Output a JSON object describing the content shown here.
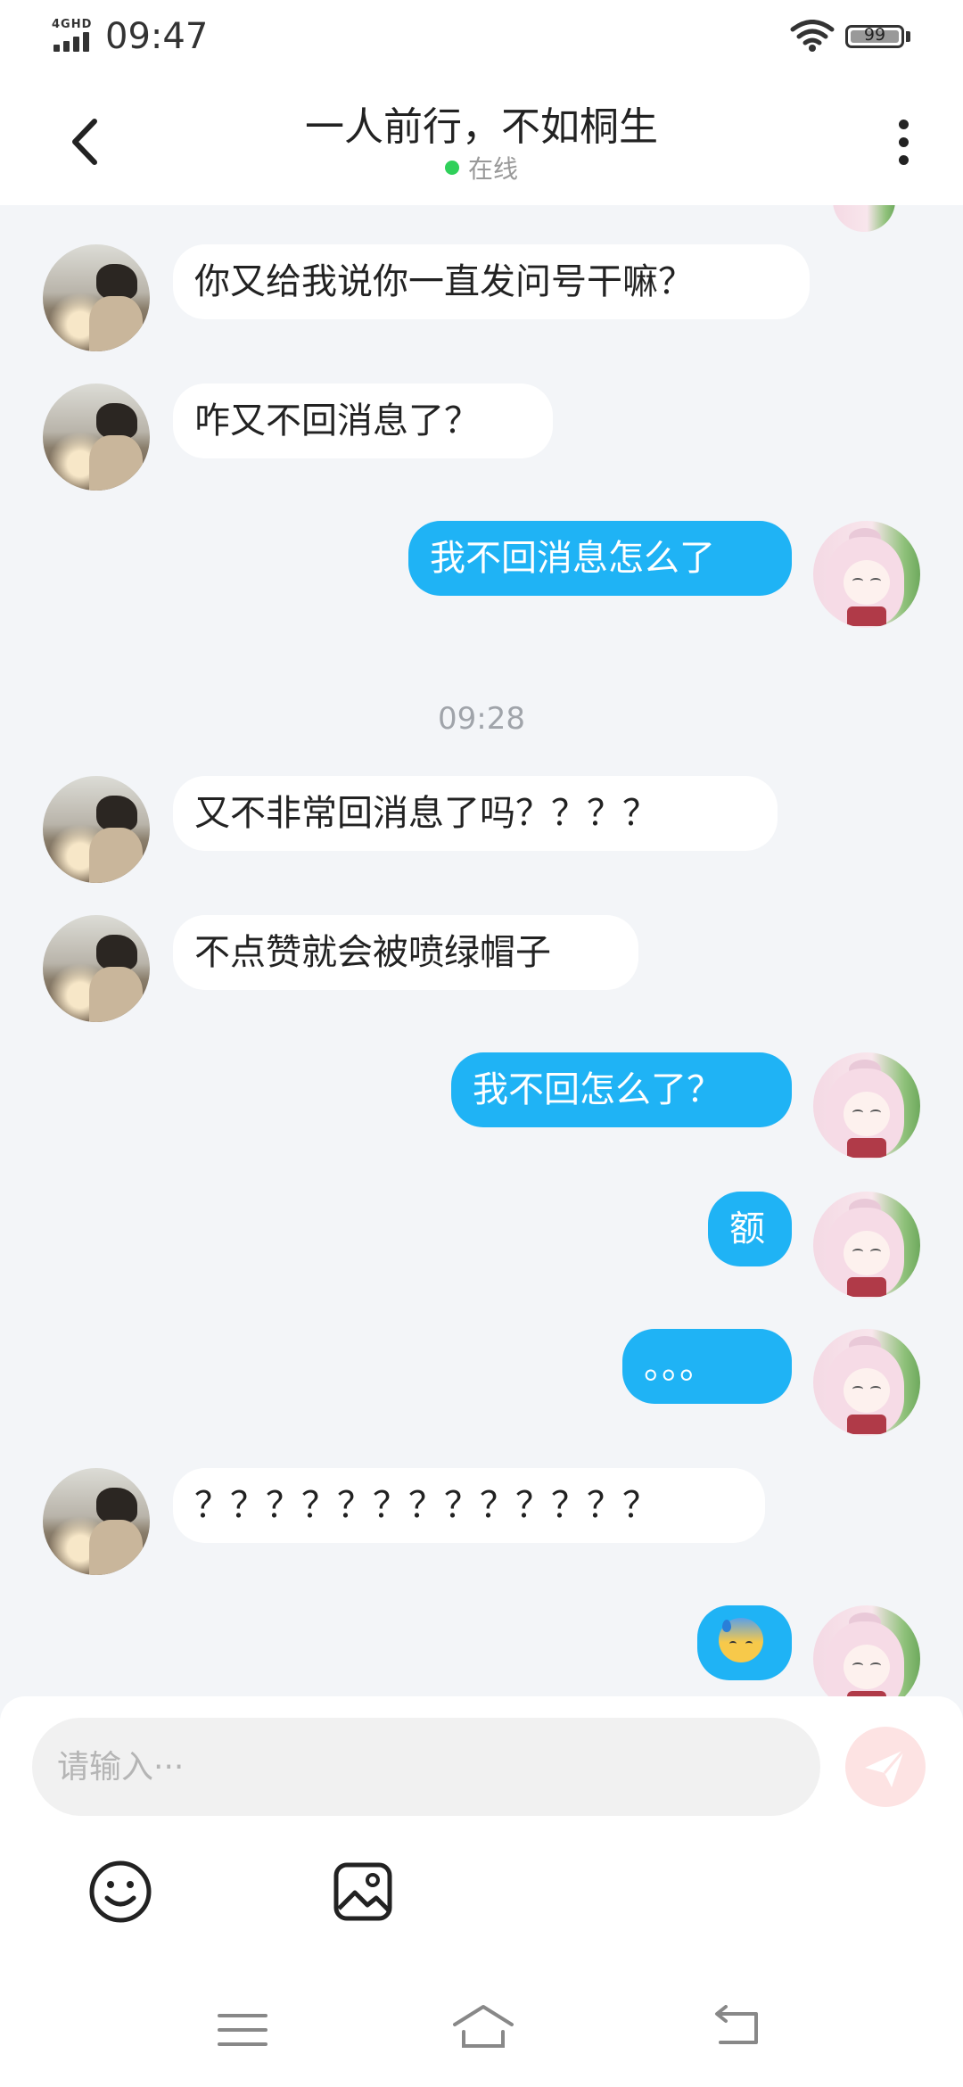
{
  "status_bar": {
    "network": "4GHD",
    "time": "09:47",
    "battery": "99"
  },
  "header": {
    "back_icon": "chevron-left-icon",
    "title": "一人前行，不如桐生",
    "status": "在线",
    "more_icon": "more-vertical-icon"
  },
  "messages": [
    {
      "side": "in",
      "text": "你又给我说你一直发问号干嘛？"
    },
    {
      "side": "in",
      "text": "咋又不回消息了？"
    },
    {
      "side": "out",
      "text": "我不回消息怎么了"
    },
    {
      "timestamp": "09:28"
    },
    {
      "side": "in",
      "text": " 又不非常回消息了吗？？？？"
    },
    {
      "side": "in",
      "text": "不点赞就会被喷绿帽子"
    },
    {
      "side": "out",
      "text": "我不回怎么了？"
    },
    {
      "side": "out",
      "text": "额"
    },
    {
      "side": "out",
      "text": "。。。"
    },
    {
      "side": "in",
      "text": "？？？？？？？？？？？？？"
    },
    {
      "side": "out",
      "emoji": "anxious-sweat-emoji"
    }
  ],
  "input": {
    "placeholder": "请输入···",
    "value": "",
    "send_icon": "paper-plane-icon",
    "emoji_icon": "smiley-icon",
    "image_icon": "image-icon"
  },
  "nav": {
    "menu_icon": "menu-icon",
    "home_icon": "home-icon",
    "back_icon": "back-arrow-icon"
  },
  "colors": {
    "outgoing_bubble": "#1fb3f5",
    "incoming_bubble": "#ffffff",
    "online_dot": "#2fd05a",
    "background": "#f3f5f8"
  }
}
